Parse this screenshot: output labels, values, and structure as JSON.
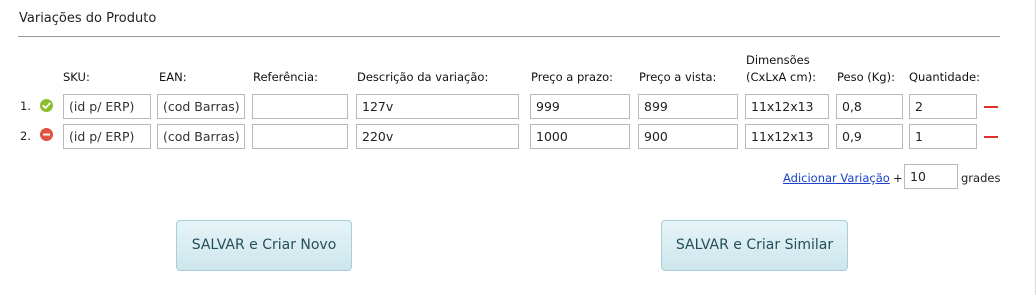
{
  "section": {
    "title": "Variações do Produto"
  },
  "columns": {
    "sku": "SKU:",
    "ean": "EAN:",
    "referencia": "Referência:",
    "descricao": "Descrição da variação:",
    "preco_prazo": "Preço a prazo:",
    "preco_vista": "Preço a vista:",
    "dimensoes_line1": "Dimensões",
    "dimensoes_line2": "(CxLxA cm):",
    "peso": "Peso (Kg):",
    "quantidade": "Quantidade:"
  },
  "rows": [
    {
      "number": "1.",
      "status": "ok",
      "sku_placeholder": "(id p/ ERP)",
      "ean_placeholder": "(cod Barras)",
      "referencia": "",
      "descricao": "127v",
      "preco_prazo": "999",
      "preco_vista": "899",
      "dimensoes": "11x12x13",
      "peso": "0,8",
      "quantidade": "2"
    },
    {
      "number": "2.",
      "status": "error",
      "sku_placeholder": "(id p/ ERP)",
      "ean_placeholder": "(cod Barras)",
      "referencia": "",
      "descricao": "220v",
      "preco_prazo": "1000",
      "preco_vista": "900",
      "dimensoes": "11x12x13",
      "peso": "0,9",
      "quantidade": "1"
    }
  ],
  "add_variation": {
    "link_label": "Adicionar Variação",
    "plus": "+",
    "grades_value": "10",
    "grades_label": "grades"
  },
  "actions": {
    "save_new": "SALVAR e Criar Novo",
    "save_similar": "SALVAR e Criar Similar"
  },
  "colors": {
    "status_ok": "#8cbd2a",
    "status_error": "#e0533e",
    "remove": "#e03030",
    "link": "#1a43c8",
    "button_text": "#244e5c"
  }
}
